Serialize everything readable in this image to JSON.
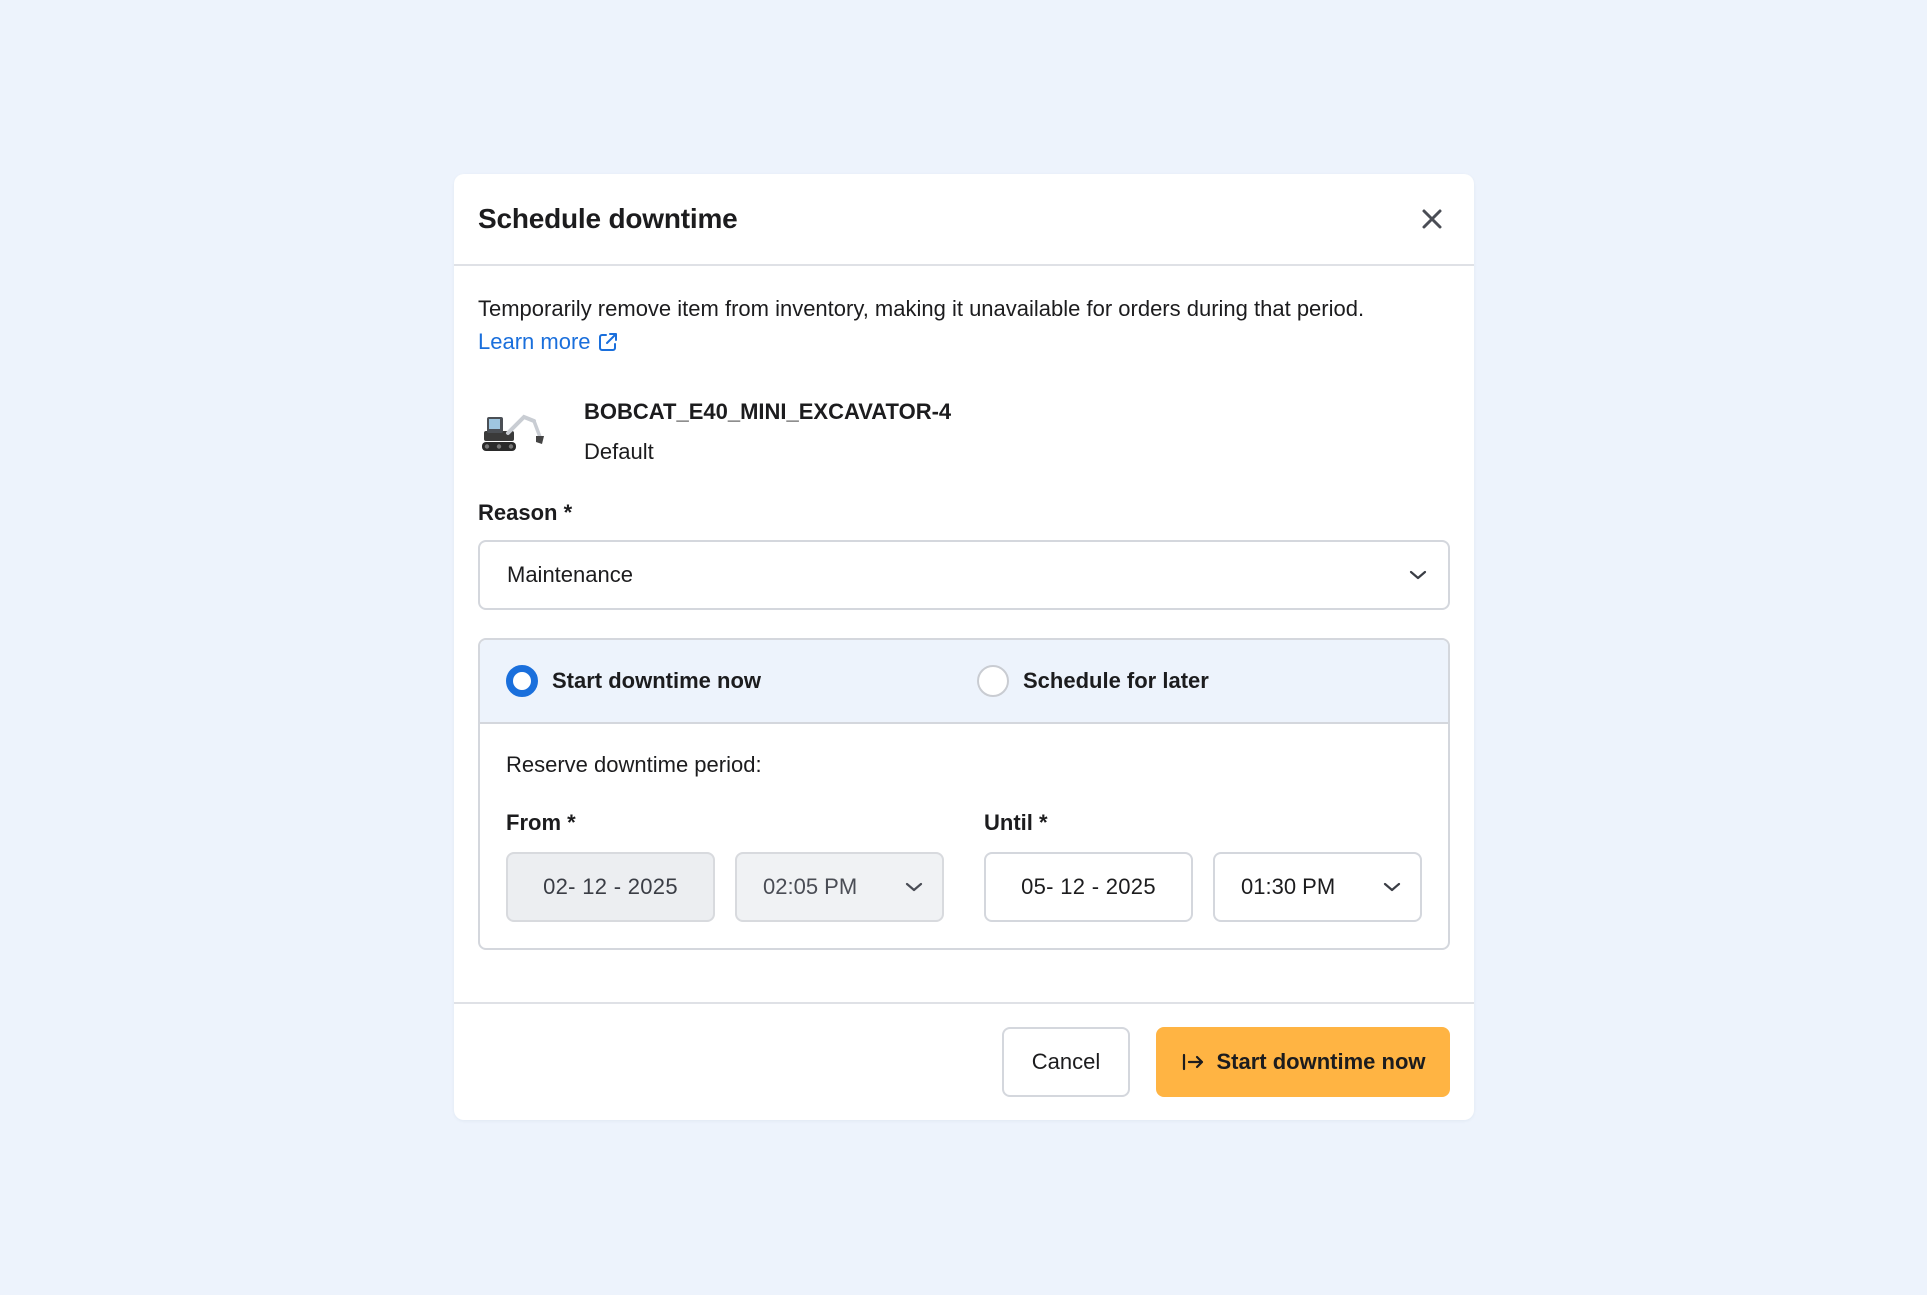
{
  "dialog": {
    "title": "Schedule downtime",
    "description": "Temporarily remove item from inventory, making it unavailable for orders during that period.",
    "learn_more": "Learn more"
  },
  "item": {
    "name": "BOBCAT_E40_MINI_EXCAVATOR-4",
    "variant": "Default"
  },
  "reason": {
    "label": "Reason *",
    "selected": "Maintenance"
  },
  "mode": {
    "options": [
      {
        "label": "Start downtime now",
        "selected": true
      },
      {
        "label": "Schedule for later",
        "selected": false
      }
    ]
  },
  "period": {
    "label": "Reserve downtime period:",
    "from": {
      "label": "From *",
      "date": "02- 12 - 2025",
      "time": "02:05 PM"
    },
    "until": {
      "label": "Until *",
      "date": "05- 12 - 2025",
      "time": "01:30 PM"
    }
  },
  "footer": {
    "cancel": "Cancel",
    "primary": "Start downtime now"
  },
  "colors": {
    "page_bg": "#edf3fc",
    "accent": "#1a6fdc",
    "primary_button": "#ffb443"
  }
}
